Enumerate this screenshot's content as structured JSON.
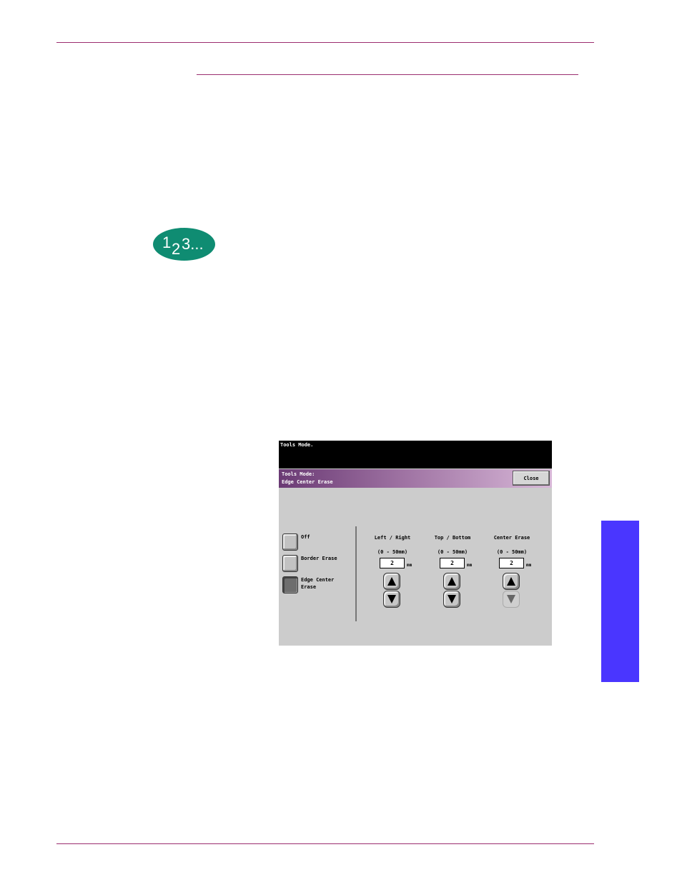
{
  "step_badge": {
    "text_a": "1",
    "text_b": "2",
    "text_c": "3...",
    "color": "#0f8c72"
  },
  "side_tab": {
    "color": "#4a36ff"
  },
  "screen": {
    "message": "Tools Mode.",
    "title_line1": "Tools Mode:",
    "title_line2": "Edge Center Erase",
    "close_label": "Close",
    "options": [
      {
        "label": "Off",
        "selected": false
      },
      {
        "label": "Border Erase",
        "selected": false
      },
      {
        "label_line1": "Edge Center",
        "label_line2": "Erase",
        "selected": true
      }
    ],
    "columns": [
      {
        "heading": "Left / Right",
        "range": "(0 - 50mm)",
        "value": "2",
        "unit": "mm",
        "down_enabled": true
      },
      {
        "heading": "Top / Bottom",
        "range": "(0 - 50mm)",
        "value": "2",
        "unit": "mm",
        "down_enabled": true
      },
      {
        "heading": "Center Erase",
        "range": "(0 - 50mm)",
        "value": "2",
        "unit": "mm",
        "down_enabled": false
      }
    ]
  }
}
